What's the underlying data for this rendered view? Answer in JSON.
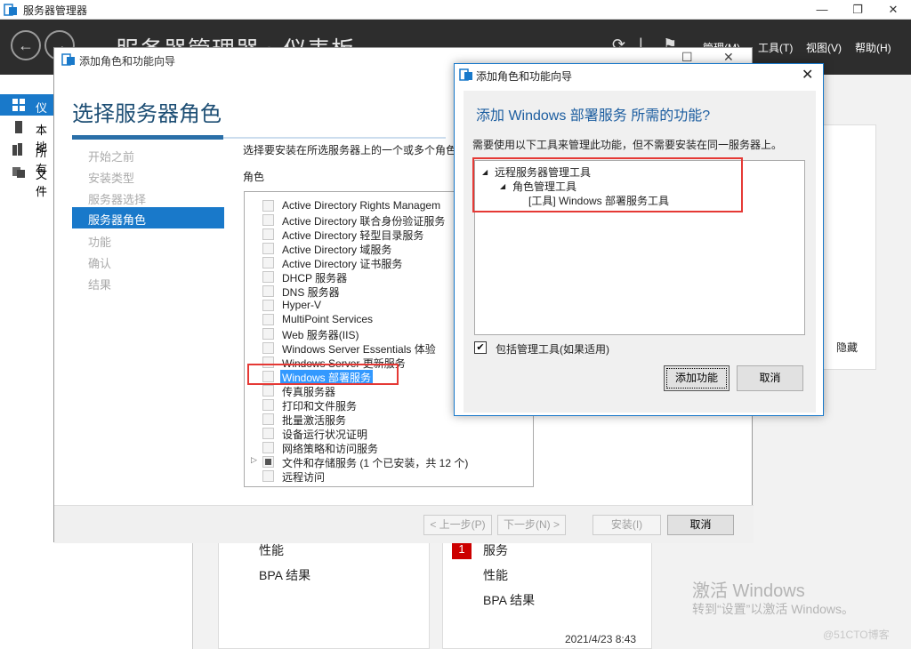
{
  "server_manager": {
    "title": "服务器管理器",
    "breadcrumb": "服务器管理器 › 仪表板",
    "menu": {
      "manage": "管理(M)",
      "tools": "工具(T)",
      "view": "视图(V)",
      "help": "帮助(H)"
    },
    "nav": [
      {
        "label": "仪表"
      },
      {
        "label": "本地"
      },
      {
        "label": "所有"
      },
      {
        "label": "文件"
      }
    ],
    "tiles": {
      "left": {
        "perf": "性能",
        "bpa": "BPA 结果"
      },
      "right": {
        "badge": "1",
        "services": "服务",
        "perf": "性能",
        "bpa": "BPA 结果"
      }
    },
    "side_hide": "隐藏",
    "datetime": "2021/4/23 8:43",
    "activation": {
      "line1": "激活 Windows",
      "line2": "转到“设置”以激活 Windows。"
    },
    "watermark": "@51CTO博客"
  },
  "wizard": {
    "title": "添加角色和功能向导",
    "heading": "选择服务器角色",
    "steps": [
      "开始之前",
      "安装类型",
      "服务器选择",
      "服务器角色",
      "功能",
      "确认",
      "结果"
    ],
    "active_step_index": 3,
    "description": "选择要安装在所选服务器上的一个或多个角色",
    "roles_heading": "角色",
    "roles": [
      "Active Directory Rights Managem",
      "Active Directory 联合身份验证服务",
      "Active Directory 轻型目录服务",
      "Active Directory 域服务",
      "Active Directory 证书服务",
      "DHCP 服务器",
      "DNS 服务器",
      "Hyper-V",
      "MultiPoint Services",
      "Web 服务器(IIS)",
      "Windows Server Essentials 体验",
      "Windows Server 更新服务",
      "Windows 部署服务",
      "传真服务器",
      "打印和文件服务",
      "批量激活服务",
      "设备运行状况证明",
      "网络策略和访问服务",
      "文件和存储服务 (1 个已安装，共 12 个)",
      "远程访问"
    ],
    "selected_role_index": 12,
    "buttons": {
      "prev": "< 上一步(P)",
      "next": "下一步(N) >",
      "install": "安装(I)",
      "cancel": "取消"
    }
  },
  "dialog": {
    "title": "添加角色和功能向导",
    "heading": "添加 Windows 部署服务 所需的功能?",
    "description": "需要使用以下工具来管理此功能，但不需要安装在同一服务器上。",
    "tree": [
      {
        "label": "远程服务器管理工具",
        "level": 0
      },
      {
        "label": "角色管理工具",
        "level": 1
      },
      {
        "label": "[工具] Windows 部署服务工具",
        "level": 2
      }
    ],
    "include_tools_label": "包括管理工具(如果适用)",
    "include_tools_checked": true,
    "check_glyph": "✔",
    "buttons": {
      "add": "添加功能",
      "cancel": "取消"
    }
  },
  "colors": {
    "accent": "#1979ca",
    "header_bg": "#2d2d2d",
    "highlight": "#e53935",
    "heading": "#1d4e74"
  }
}
